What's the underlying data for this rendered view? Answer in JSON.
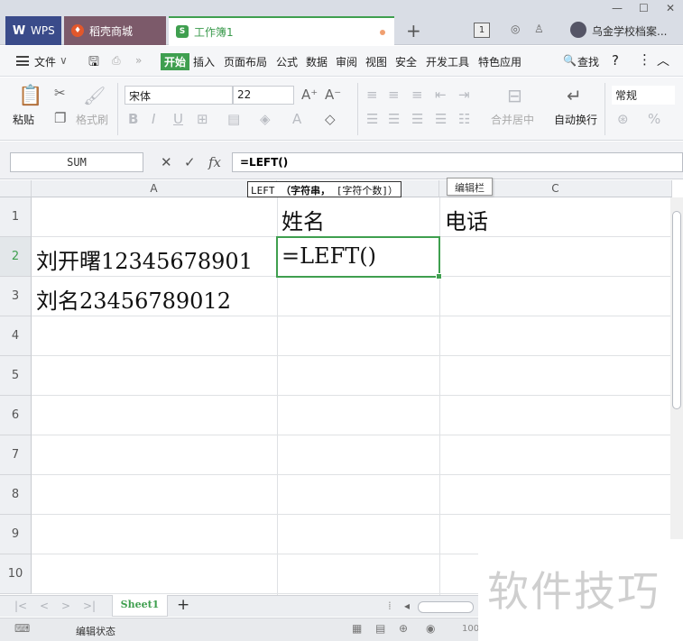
{
  "tabs": {
    "wps": "WPS",
    "store": "稻壳商城",
    "workbook": "工作簿1",
    "new_tab": "+",
    "badge": "1",
    "user": "乌金学校档案..."
  },
  "menu": {
    "file": "文件",
    "items": [
      "开始",
      "插入",
      "页面布局",
      "公式",
      "数据",
      "审阅",
      "视图",
      "安全",
      "开发工具",
      "特色应用"
    ],
    "search": "查找",
    "help": "?"
  },
  "ribbon": {
    "paste": "粘贴",
    "format_painter": "格式刷",
    "font_name": "宋体",
    "font_size": "22",
    "merge_center": "合并居中",
    "wrap_text": "自动换行",
    "number_format": "常规",
    "percent": "%"
  },
  "formula_bar": {
    "name_box": "SUM",
    "fx": "fx",
    "formula": "=LEFT()"
  },
  "tooltips": {
    "function_hint_name": "LEFT",
    "function_hint_bold": "（字符串，",
    "function_hint_rest": "[字符个数]）",
    "edit_bar": "编辑栏"
  },
  "grid": {
    "columns": [
      "A",
      "B",
      "C"
    ],
    "rows": [
      "1",
      "2",
      "3",
      "4",
      "5",
      "6",
      "7",
      "8",
      "9",
      "10"
    ],
    "cells": {
      "B1": "姓名",
      "C1": "电话",
      "A2": "刘开曙12345678901",
      "B2": "=LEFT()",
      "A3": "刘名23456789012"
    },
    "active_cell": "B2"
  },
  "sheets": {
    "tabs": [
      "Sheet1"
    ],
    "add": "+"
  },
  "status": {
    "mode": "编辑状态",
    "zoom": "100"
  },
  "watermark": "软件技巧",
  "colors": {
    "accent_green": "#3f9f4f",
    "tab_bar": "#d9dde5"
  }
}
